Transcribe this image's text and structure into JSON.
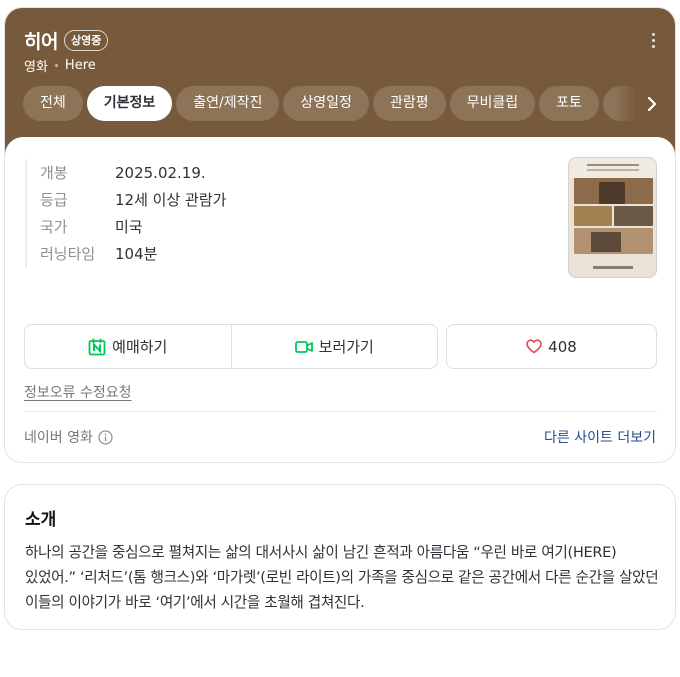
{
  "movie": {
    "title": "히어",
    "status_badge": "상영중",
    "category": "영화",
    "english_title": "Here"
  },
  "tabs": [
    {
      "label": "전체",
      "active": false
    },
    {
      "label": "기본정보",
      "active": true
    },
    {
      "label": "출연/제작진",
      "active": false
    },
    {
      "label": "상영일정",
      "active": false
    },
    {
      "label": "관람평",
      "active": false
    },
    {
      "label": "무비클립",
      "active": false
    },
    {
      "label": "포토",
      "active": false
    }
  ],
  "info": [
    {
      "key": "개봉",
      "value": "2025.02.19."
    },
    {
      "key": "등급",
      "value": "12세 이상 관람가"
    },
    {
      "key": "국가",
      "value": "미국"
    },
    {
      "key": "러닝타임",
      "value": "104분"
    }
  ],
  "actions": {
    "reserve_label": "예매하기",
    "watch_label": "보러가기",
    "like_count": "408"
  },
  "error_report_link": "정보오류 수정요청",
  "footer": {
    "source": "네이버 영화",
    "more_sites": "다른 사이트 더보기"
  },
  "intro": {
    "heading": "소개",
    "text": "하나의 공간을 중심으로 펼쳐지는 삶의 대서사시 삶이 남긴 흔적과 아름다움 “우린 바로 여기(HERE) 있었어.” ‘리처드’(톰 행크스)와 ‘마가렛’(로빈 라이트)의 가족을 중심으로 같은 공간에서 다른 순간을 살았던 이들의 이야기가 바로 ‘여기’에서 시간을 초월해 겹쳐진다."
  },
  "colors": {
    "header_brown": "#775a3c",
    "tab_brown": "#8d7357",
    "naver_green": "#03c75a",
    "like_red": "#e04855",
    "link_blue": "#2a4c8c"
  }
}
